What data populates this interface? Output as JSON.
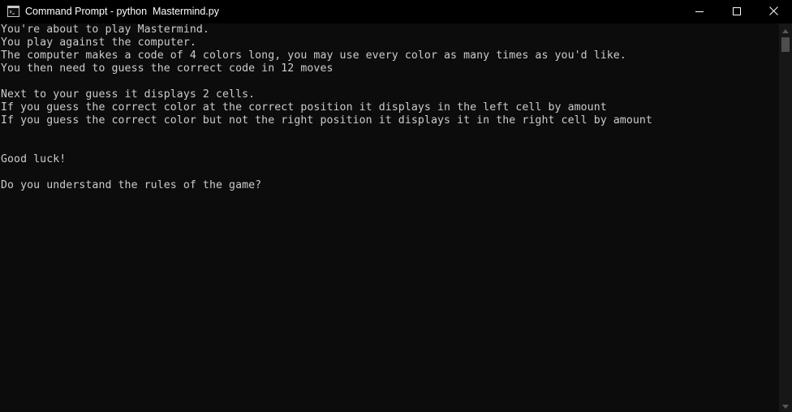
{
  "window": {
    "title": "Command Prompt - python  Mastermind.py"
  },
  "console": {
    "lines": [
      "You're about to play Mastermind.",
      "You play against the computer.",
      "The computer makes a code of 4 colors long, you may use every color as many times as you'd like.",
      "You then need to guess the correct code in 12 moves",
      "",
      "Next to your guess it displays 2 cells.",
      "If you guess the correct color at the correct position it displays in the left cell by amount",
      "If you guess the correct color but not the right position it displays it in the right cell by amount",
      "",
      "",
      "Good luck!",
      "",
      "Do you understand the rules of the game?"
    ]
  },
  "icons": {
    "app": "command-prompt-icon",
    "minimize": "minimize-icon",
    "maximize": "maximize-icon",
    "close": "close-icon",
    "scroll_up": "arrow-up-icon",
    "scroll_down": "arrow-down-icon"
  },
  "colors": {
    "background": "#0c0c0c",
    "text": "#cccccc",
    "titlebar": "#000000",
    "title_text": "#ffffff"
  }
}
